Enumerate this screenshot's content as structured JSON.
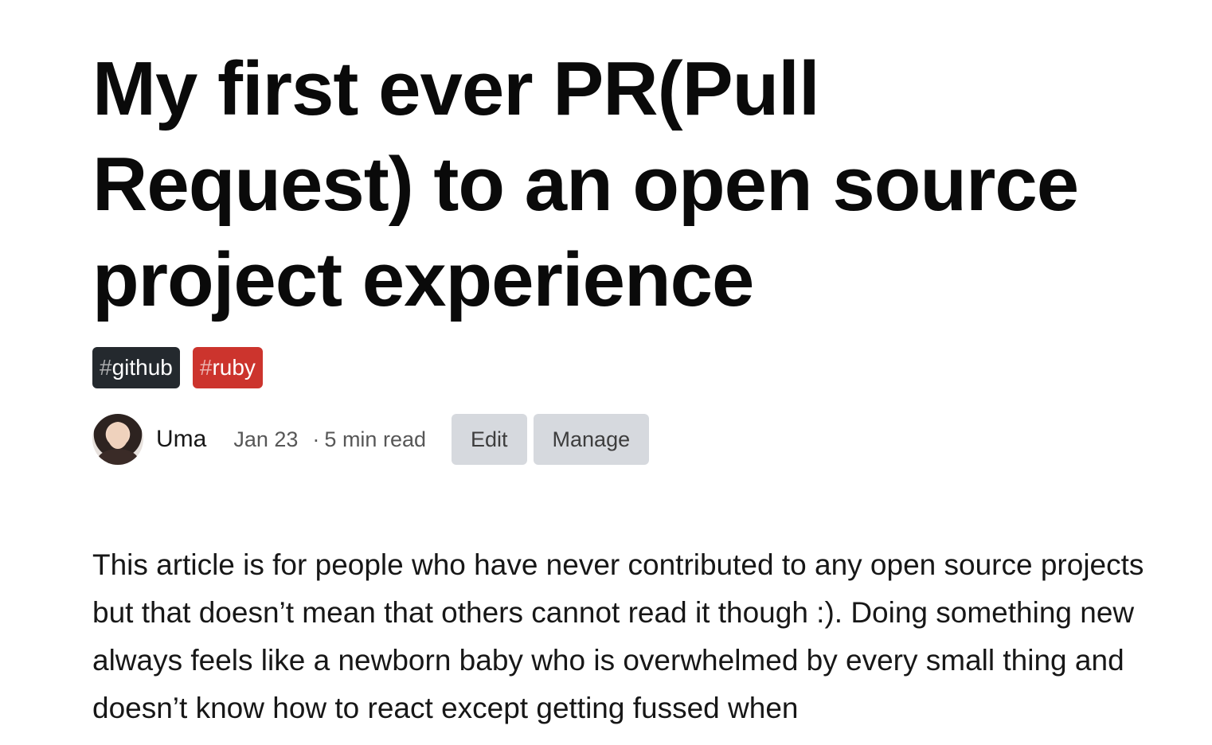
{
  "article": {
    "title": "My first ever PR(Pull Request) to an open source project experience",
    "tags": [
      {
        "hash": "#",
        "name": "github",
        "color": "#24292e"
      },
      {
        "hash": "#",
        "name": "ruby",
        "color": "#cc342d"
      }
    ],
    "author": "Uma",
    "date": "Jan 23",
    "separator": "·",
    "read_time": "5 min read",
    "actions": {
      "edit_label": "Edit",
      "manage_label": "Manage"
    },
    "body": "This article is for people who have never contributed to any open source projects but that doesn’t mean that others cannot read it though :). Doing something new always feels like a newborn baby who is overwhelmed by every small thing and doesn’t know how to react except getting fussed when"
  }
}
